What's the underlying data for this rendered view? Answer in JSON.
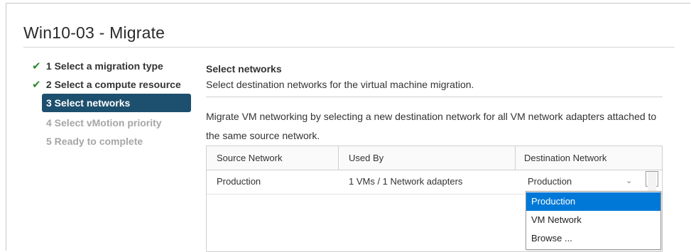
{
  "dialog": {
    "title": "Win10-03 - Migrate"
  },
  "steps": [
    {
      "label": "1 Select a migration type",
      "state": "done"
    },
    {
      "label": "2 Select a compute resource",
      "state": "done"
    },
    {
      "label": "3 Select networks",
      "state": "active"
    },
    {
      "label": "4 Select vMotion priority",
      "state": "disabled"
    },
    {
      "label": "5 Ready to complete",
      "state": "disabled"
    }
  ],
  "main": {
    "title": "Select networks",
    "subtitle": "Select destination networks for the virtual machine migration.",
    "description": "Migrate VM networking by selecting a new destination network for all VM network adapters attached to the same source network."
  },
  "table": {
    "headers": [
      "Source Network",
      "Used By",
      "Destination Network"
    ],
    "rows": [
      {
        "source": "Production",
        "used_by": "1 VMs / 1 Network adapters",
        "destination": "Production"
      }
    ]
  },
  "dropdown": {
    "options": [
      "Production",
      "VM Network",
      "Browse ..."
    ],
    "highlighted": "Production"
  },
  "colors": {
    "active_step_bg": "#1d4f6e",
    "check_green": "#2f8a2f",
    "option_highlight": "#0078d7"
  },
  "icons": {
    "check": "checkmark-icon",
    "chevron": "chevron-down-icon",
    "scroll_up": "chevron-up-icon"
  }
}
